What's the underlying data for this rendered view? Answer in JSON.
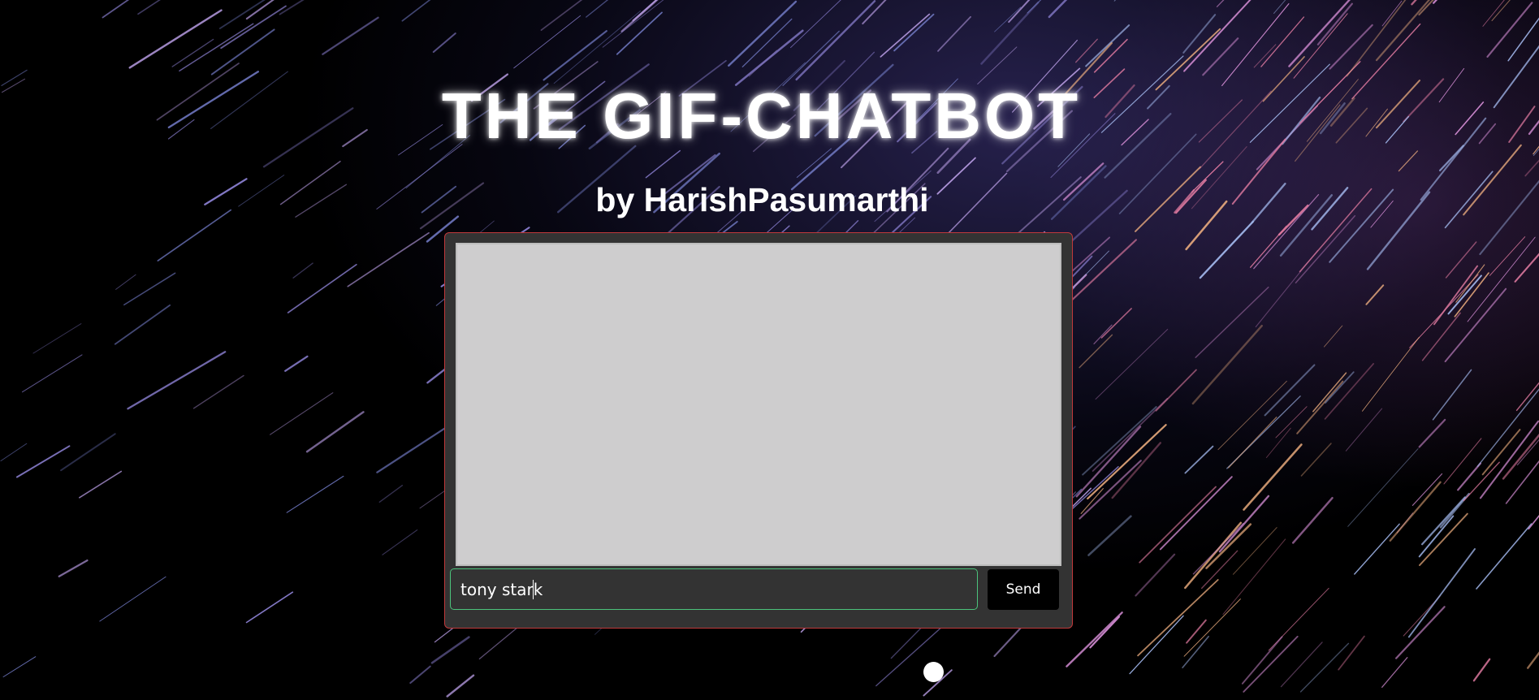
{
  "header": {
    "title": "THE GIF-CHATBOT",
    "subtitle": "by HarishPasumarthi"
  },
  "chat": {
    "input_value": "tony stark",
    "send_label": "Send"
  },
  "colors": {
    "panel_background": "#333333",
    "panel_border": "#c0393b",
    "chat_log_background": "#cecdce",
    "input_border": "#4cc47c",
    "send_button_background": "#000000"
  },
  "icons": {
    "floating_dot": "circle-icon"
  }
}
